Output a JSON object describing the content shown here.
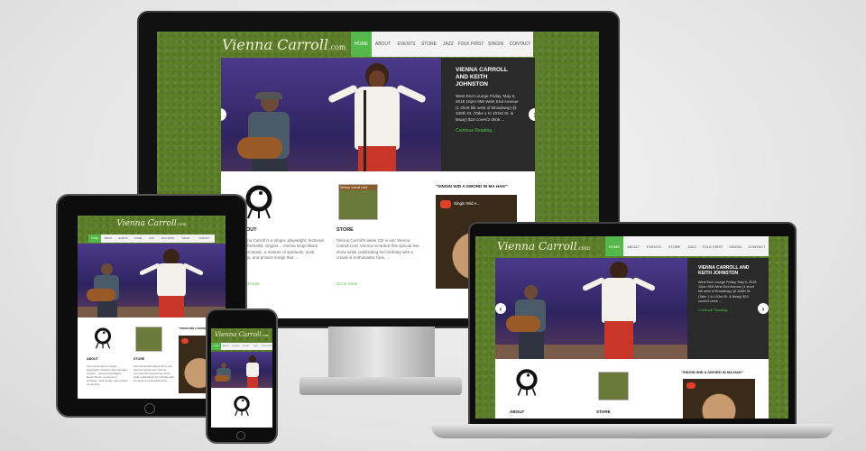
{
  "logo": {
    "name": "Vienna Carroll",
    "suffix": ".com"
  },
  "nav": [
    "HOME",
    "ABOUT",
    "EVENTS",
    "STORE",
    "JAZZ",
    "FOLK FIRST",
    "SINGIN",
    "CONTACT"
  ],
  "tablet_nav": [
    "HOME",
    "ABOUT",
    "EVENTS",
    "STORE",
    "JAZZ",
    "FOLK FIRST",
    "SINGIN",
    "CONTACT"
  ],
  "phone_nav": [
    "HOME",
    "ABOUT",
    "EVENTS",
    "STORE",
    "JAZZ",
    "FOLK FIRST"
  ],
  "slide": {
    "title": "VIENNA CARROLL AND KEITH JOHNSTON",
    "body": "West End Lounge Friday, May 6, 2016 10pm 955 West End Avenue (1 short blk west of Broadway) @ 106th St. (Take 1 to 103rd St. & Bway) $10 cover/2 drink ...",
    "link": "Continue Reading...",
    "prev": "‹",
    "next": "›"
  },
  "sections": {
    "about": {
      "heading": "ABOUT",
      "text": "Vienna Carroll is a singer, playwright, historian and herbalist. Origins... Vienna sings Black Roots Music, a mixture of spirituals, work songs, and protest songs that ...",
      "link": "Read more"
    },
    "store": {
      "heading": "STORE",
      "text": "Vienna Carroll's latest CD is out: Vienna Carroll Live! Vienna recorded this special live show while celebrating her birthday with a crowd of enthusiastic fans, ...",
      "link": "Go to Store",
      "cd_label": "Vienna Carroll Live!"
    },
    "video": {
      "heading": "\"SINGIN WID A SWORD IN MA HAN'\"",
      "title": "Singin Wid A..."
    }
  },
  "colors": {
    "accent": "#55b84a",
    "site_bg": "#5d7f2a",
    "caption_bg": "#2a2a2a"
  },
  "icons": {
    "logo_mark": "sankofa-bird-icon",
    "play": "play-icon"
  }
}
